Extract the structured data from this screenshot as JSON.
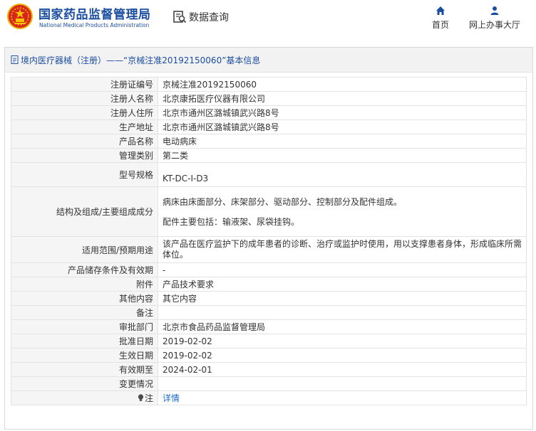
{
  "header": {
    "brand_cn": "国家药品监督管理局",
    "brand_en": "National Medical Products Administration",
    "query_label": "数据查询",
    "nav": [
      {
        "label": "首页",
        "icon": "home-icon"
      },
      {
        "label": "网上办事大厅",
        "icon": "user-icon"
      }
    ]
  },
  "panel": {
    "title": "境内医疗器械（注册）——“京械注准20192150060”基本信息"
  },
  "fields": {
    "reg_no": {
      "label": "注册证编号",
      "value": "京械注准20192150060"
    },
    "registrant": {
      "label": "注册人名称",
      "value": "北京康拓医疗仪器有限公司"
    },
    "registrant_addr": {
      "label": "注册人住所",
      "value": "北京市通州区潞城镇武兴路8号"
    },
    "prod_addr": {
      "label": "生产地址",
      "value": "北京市通州区潞城镇武兴路8号"
    },
    "product_name": {
      "label": "产品名称",
      "value": "电动病床"
    },
    "mgmt_class": {
      "label": "管理类别",
      "value": "第二类"
    },
    "model": {
      "label": "型号规格",
      "value": "KT-DC-I-D3"
    },
    "structure": {
      "label": "结构及组成/主要组成成分",
      "value": "病床由床面部分、床架部分、驱动部分、控制部分及配件组成。",
      "value2": "配件主要包括：输液架、尿袋挂钩。"
    },
    "usage": {
      "label": "适用范围/预期用途",
      "value": "该产品在医疗监护下的成年患者的诊断、治疗或监护时使用，用以支撑患者身体，形成临床所需体位。"
    },
    "storage": {
      "label": "产品储存条件及有效期",
      "value": "-"
    },
    "attachment": {
      "label": "附件",
      "value": "产品技术要求"
    },
    "other": {
      "label": "其他内容",
      "value": "其它内容"
    },
    "remark": {
      "label": "备注",
      "value": ""
    },
    "authority": {
      "label": "审批部门",
      "value": "北京市食品药品监督管理局"
    },
    "approve_date": {
      "label": "批准日期",
      "value": "2019-02-02"
    },
    "effective_date": {
      "label": "生效日期",
      "value": "2019-02-02"
    },
    "expiry_date": {
      "label": "有效期至",
      "value": "2024-02-01"
    },
    "change": {
      "label": "变更情况",
      "value": ""
    },
    "note": {
      "label": "注",
      "value": "详情"
    }
  },
  "colors": {
    "brand": "#1b4ea0",
    "link": "#1b6ac9",
    "label_bg": "#f5f5f5"
  }
}
